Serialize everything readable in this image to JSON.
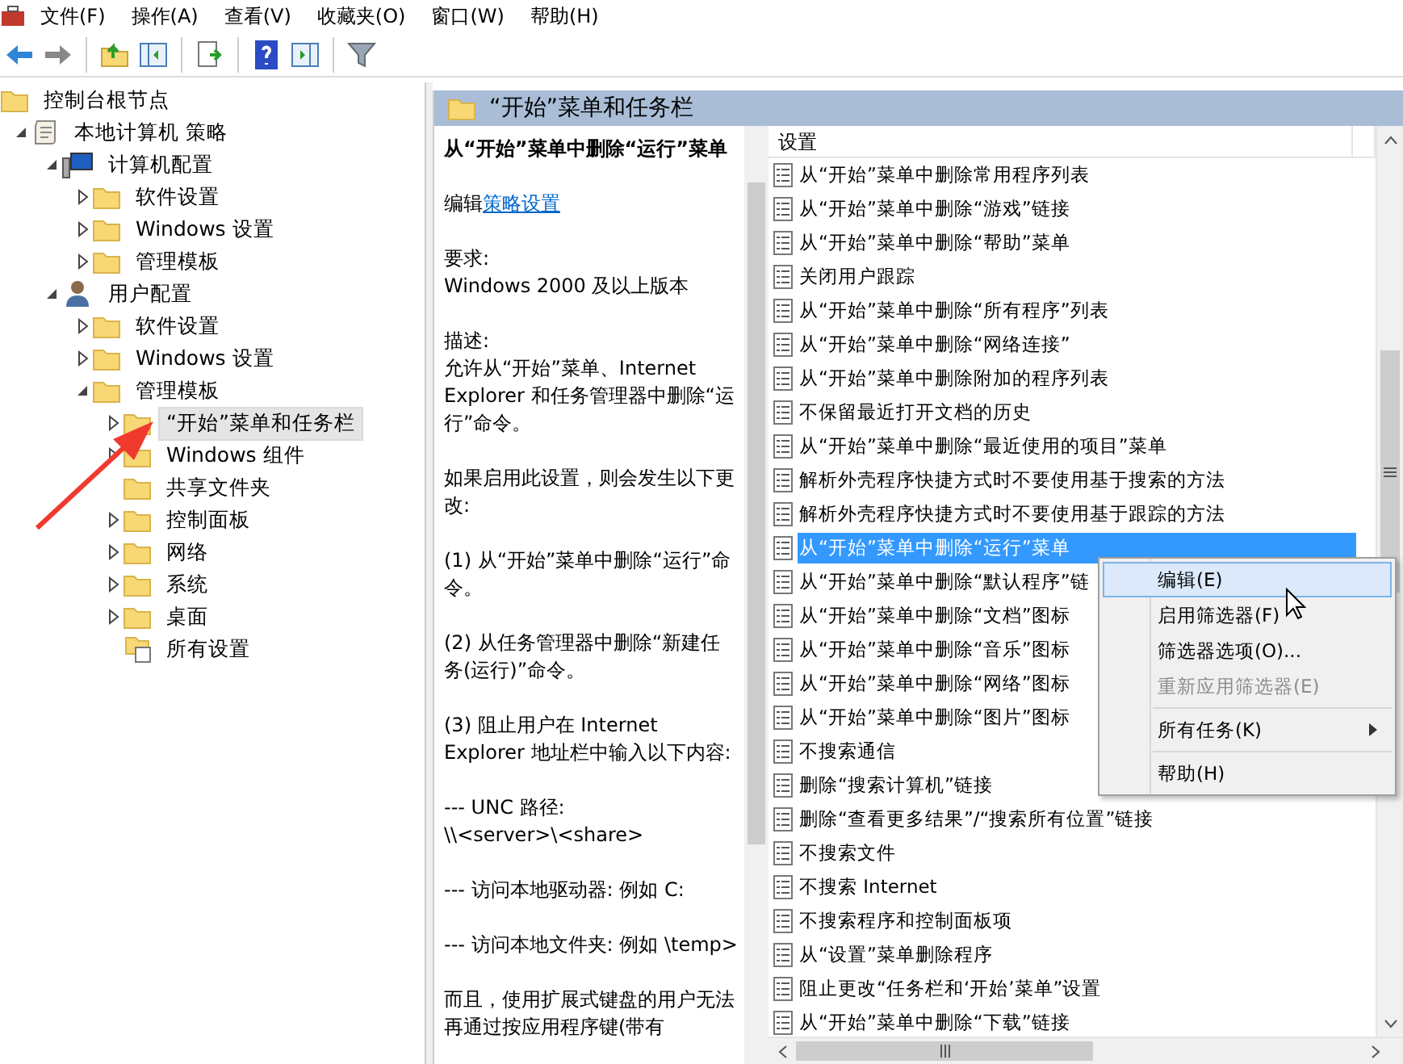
{
  "menu_bar": [
    "文件(F)",
    "操作(A)",
    "查看(V)",
    "收藏夹(O)",
    "窗口(W)",
    "帮助(H)"
  ],
  "tree": [
    {
      "label": "控制台根节点",
      "kind": "folder",
      "expandable": false,
      "selected": false,
      "children": [
        {
          "label": "本地计算机 策略",
          "kind": "policy",
          "expandable": true,
          "expanded": true,
          "selected": false,
          "children": [
            {
              "label": "计算机配置",
              "kind": "computer",
              "expandable": true,
              "expanded": true,
              "selected": false,
              "children": [
                {
                  "label": "软件设置",
                  "kind": "folder",
                  "expandable": true,
                  "expanded": false,
                  "selected": false
                },
                {
                  "label": "Windows 设置",
                  "kind": "folder",
                  "expandable": true,
                  "expanded": false,
                  "selected": false
                },
                {
                  "label": "管理模板",
                  "kind": "folder",
                  "expandable": true,
                  "expanded": false,
                  "selected": false
                }
              ]
            },
            {
              "label": "用户配置",
              "kind": "user",
              "expandable": true,
              "expanded": true,
              "selected": false,
              "children": [
                {
                  "label": "软件设置",
                  "kind": "folder",
                  "expandable": true,
                  "expanded": false,
                  "selected": false
                },
                {
                  "label": "Windows 设置",
                  "kind": "folder",
                  "expandable": true,
                  "expanded": false,
                  "selected": false
                },
                {
                  "label": "管理模板",
                  "kind": "folder",
                  "expandable": true,
                  "expanded": true,
                  "selected": false,
                  "children": [
                    {
                      "label": "“开始”菜单和任务栏",
                      "kind": "folder",
                      "expandable": true,
                      "expanded": false,
                      "selected": true
                    },
                    {
                      "label": "Windows 组件",
                      "kind": "folder",
                      "expandable": true,
                      "expanded": false,
                      "selected": false
                    },
                    {
                      "label": "共享文件夹",
                      "kind": "folder",
                      "expandable": false,
                      "selected": false
                    },
                    {
                      "label": "控制面板",
                      "kind": "folder",
                      "expandable": true,
                      "expanded": false,
                      "selected": false
                    },
                    {
                      "label": "网络",
                      "kind": "folder",
                      "expandable": true,
                      "expanded": false,
                      "selected": false
                    },
                    {
                      "label": "系统",
                      "kind": "folder",
                      "expandable": true,
                      "expanded": false,
                      "selected": false
                    },
                    {
                      "label": "桌面",
                      "kind": "folder",
                      "expandable": true,
                      "expanded": false,
                      "selected": false
                    },
                    {
                      "label": "所有设置",
                      "kind": "settings",
                      "expandable": false,
                      "selected": false
                    }
                  ]
                }
              ]
            }
          ]
        }
      ]
    }
  ],
  "details_header": "“开始”菜单和任务栏",
  "description": {
    "title": "从“开始”菜单中删除“运行”菜单",
    "edit_prefix": "编辑",
    "edit_link": "策略设置",
    "paragraphs": [
      "要求:\nWindows 2000 及以上版本",
      "描述:\n允许从“开始”菜单、Internet Explorer 和任务管理器中删除“运行”命令。",
      "如果启用此设置，则会发生以下更改:",
      "(1) 从“开始”菜单中删除“运行”命令。",
      "(2) 从任务管理器中删除“新建任务(运行)”命令。",
      "(3) 阻止用户在 Internet Explorer 地址栏中输入以下内容:",
      "--- UNC 路径:\n\\\\<server>\\<share>",
      "--- 访问本地驱动器: 例如 C:",
      "--- 访问本地文件夹: 例如 \\temp>",
      "而且，使用扩展式键盘的用户无法再通过按应用程序键(带有"
    ]
  },
  "settings_list": {
    "columns": [
      "设置"
    ],
    "rows": [
      {
        "label": "从“开始”菜单中删除常用程序列表",
        "selected": false
      },
      {
        "label": "从“开始”菜单中删除“游戏”链接",
        "selected": false
      },
      {
        "label": "从“开始”菜单中删除“帮助”菜单",
        "selected": false
      },
      {
        "label": "关闭用户跟踪",
        "selected": false
      },
      {
        "label": "从“开始”菜单中删除“所有程序”列表",
        "selected": false
      },
      {
        "label": "从“开始”菜单中删除“网络连接”",
        "selected": false
      },
      {
        "label": "从“开始”菜单中删除附加的程序列表",
        "selected": false
      },
      {
        "label": "不保留最近打开文档的历史",
        "selected": false
      },
      {
        "label": "从“开始”菜单中删除“最近使用的项目”菜单",
        "selected": false
      },
      {
        "label": "解析外壳程序快捷方式时不要使用基于搜索的方法",
        "selected": false
      },
      {
        "label": "解析外壳程序快捷方式时不要使用基于跟踪的方法",
        "selected": false
      },
      {
        "label": "从“开始”菜单中删除“运行”菜单",
        "selected": true
      },
      {
        "label": "从“开始”菜单中删除“默认程序”链",
        "selected": false
      },
      {
        "label": "从“开始”菜单中删除“文档”图标",
        "selected": false
      },
      {
        "label": "从“开始”菜单中删除“音乐”图标",
        "selected": false
      },
      {
        "label": "从“开始”菜单中删除“网络”图标",
        "selected": false
      },
      {
        "label": "从“开始”菜单中删除“图片”图标",
        "selected": false
      },
      {
        "label": "不搜索通信",
        "selected": false
      },
      {
        "label": "删除“搜索计算机”链接",
        "selected": false
      },
      {
        "label": "删除“查看更多结果”/“搜索所有位置”链接",
        "selected": false
      },
      {
        "label": "不搜索文件",
        "selected": false
      },
      {
        "label": "不搜索 Internet",
        "selected": false
      },
      {
        "label": "不搜索程序和控制面板项",
        "selected": false
      },
      {
        "label": "从“设置”菜单删除程序",
        "selected": false
      },
      {
        "label": "阻止更改“任务栏和‘开始’菜单”设置",
        "selected": false
      },
      {
        "label": "从“开始”菜单中删除“下载”链接",
        "selected": false
      }
    ]
  },
  "context_menu": [
    {
      "kind": "item",
      "label": "编辑(E)",
      "selected": true,
      "disabled": false,
      "submenu": false
    },
    {
      "kind": "item",
      "label": "启用筛选器(F)",
      "selected": false,
      "disabled": false,
      "submenu": false
    },
    {
      "kind": "item",
      "label": "筛选器选项(O)...",
      "selected": false,
      "disabled": false,
      "submenu": false
    },
    {
      "kind": "item",
      "label": "重新应用筛选器(E)",
      "selected": false,
      "disabled": true,
      "submenu": false
    },
    {
      "kind": "separator"
    },
    {
      "kind": "item",
      "label": "所有任务(K)",
      "selected": false,
      "disabled": false,
      "submenu": true
    },
    {
      "kind": "separator"
    },
    {
      "kind": "item",
      "label": "帮助(H)",
      "selected": false,
      "disabled": false,
      "submenu": false
    }
  ]
}
